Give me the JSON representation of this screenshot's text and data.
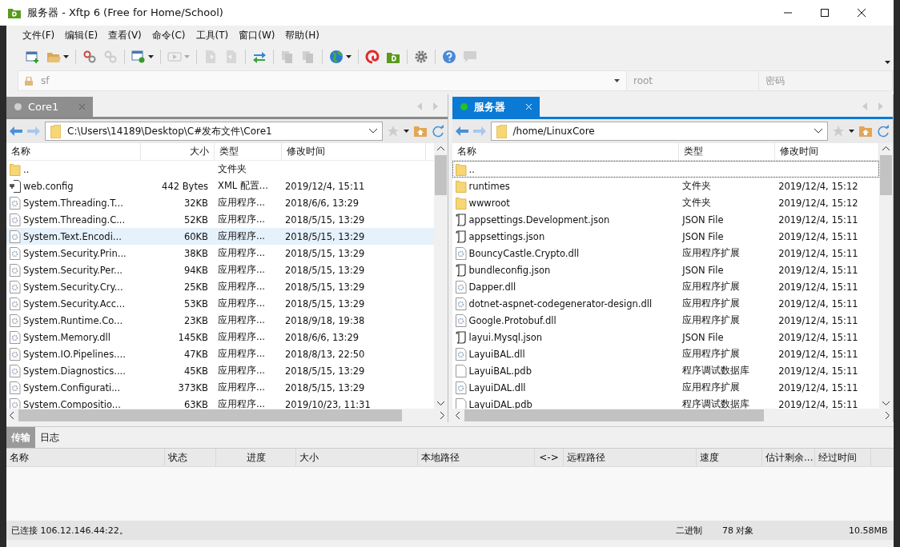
{
  "window": {
    "title": "服务器 - Xftp 6 (Free for Home/School)"
  },
  "menu": [
    "文件(F)",
    "编辑(E)",
    "查看(V)",
    "命令(C)",
    "工具(T)",
    "窗口(W)",
    "帮助(H)"
  ],
  "toolbar": [
    [
      {
        "kind": "new",
        "disabled": false,
        "dropdown": false
      },
      {
        "kind": "open",
        "disabled": false,
        "dropdown": true
      }
    ],
    [
      {
        "kind": "disconnect",
        "disabled": false,
        "dropdown": false
      },
      {
        "kind": "link",
        "disabled": true,
        "dropdown": false
      }
    ],
    [
      {
        "kind": "properties",
        "disabled": false,
        "dropdown": true
      }
    ],
    [
      {
        "kind": "play",
        "disabled": true,
        "dropdown": true
      }
    ],
    [
      {
        "kind": "upload",
        "disabled": true,
        "dropdown": false
      },
      {
        "kind": "download",
        "disabled": true,
        "dropdown": false
      }
    ],
    [
      {
        "kind": "sync",
        "disabled": false,
        "dropdown": false
      }
    ],
    [
      {
        "kind": "copy",
        "disabled": true,
        "dropdown": false
      },
      {
        "kind": "paste",
        "disabled": true,
        "dropdown": false
      }
    ],
    [
      {
        "kind": "globe",
        "disabled": false,
        "dropdown": true
      }
    ],
    [
      {
        "kind": "swirl",
        "disabled": false,
        "dropdown": false
      },
      {
        "kind": "app",
        "disabled": false,
        "dropdown": false
      }
    ],
    [
      {
        "kind": "settings",
        "disabled": false,
        "dropdown": false
      }
    ],
    [
      {
        "kind": "help",
        "disabled": false,
        "dropdown": false
      },
      {
        "kind": "chat",
        "disabled": true,
        "dropdown": false
      }
    ]
  ],
  "address_bar": {
    "host": "sf",
    "user_placeholder": "root",
    "password_placeholder": "密码"
  },
  "panes": [
    {
      "tab": {
        "label": "Core1",
        "selected": false,
        "connected": false
      },
      "path": "C:\\Users\\14189\\Desktop\\C#发布文件\\Core1",
      "columns": [
        {
          "label": "名称",
          "kind": "name"
        },
        {
          "label": "大小",
          "kind": "size"
        },
        {
          "label": "类型",
          "kind": "type"
        },
        {
          "label": "修改时间",
          "kind": "date"
        }
      ],
      "rows": [
        {
          "kind": "folder",
          "name": "..",
          "size": "",
          "type": "文件夹",
          "date": "",
          "selected": false
        },
        {
          "kind": "config",
          "name": "web.config",
          "size": "442 Bytes",
          "type": "XML 配置...",
          "date": "2019/12/4, 15:11",
          "selected": false
        },
        {
          "kind": "dll",
          "name": "System.Threading.T...",
          "size": "32KB",
          "type": "应用程序...",
          "date": "2018/6/6, 13:29",
          "selected": false
        },
        {
          "kind": "dll",
          "name": "System.Threading.C...",
          "size": "52KB",
          "type": "应用程序...",
          "date": "2018/5/15, 13:29",
          "selected": false
        },
        {
          "kind": "dll",
          "name": "System.Text.Encodi...",
          "size": "60KB",
          "type": "应用程序...",
          "date": "2018/5/15, 13:29",
          "selected": true
        },
        {
          "kind": "dll",
          "name": "System.Security.Prin...",
          "size": "38KB",
          "type": "应用程序...",
          "date": "2018/5/15, 13:29",
          "selected": false
        },
        {
          "kind": "dll",
          "name": "System.Security.Per...",
          "size": "94KB",
          "type": "应用程序...",
          "date": "2018/5/15, 13:29",
          "selected": false
        },
        {
          "kind": "dll",
          "name": "System.Security.Cry...",
          "size": "25KB",
          "type": "应用程序...",
          "date": "2018/5/15, 13:29",
          "selected": false
        },
        {
          "kind": "dll",
          "name": "System.Security.Acc...",
          "size": "53KB",
          "type": "应用程序...",
          "date": "2018/5/15, 13:29",
          "selected": false
        },
        {
          "kind": "dll",
          "name": "System.Runtime.Co...",
          "size": "23KB",
          "type": "应用程序...",
          "date": "2018/9/18, 19:38",
          "selected": false
        },
        {
          "kind": "dll",
          "name": "System.Memory.dll",
          "size": "145KB",
          "type": "应用程序...",
          "date": "2018/6/6, 13:29",
          "selected": false
        },
        {
          "kind": "dll",
          "name": "System.IO.Pipelines....",
          "size": "47KB",
          "type": "应用程序...",
          "date": "2018/8/13, 22:50",
          "selected": false
        },
        {
          "kind": "dll",
          "name": "System.Diagnostics....",
          "size": "45KB",
          "type": "应用程序...",
          "date": "2018/5/15, 13:29",
          "selected": false
        },
        {
          "kind": "dll",
          "name": "System.Configurati...",
          "size": "373KB",
          "type": "应用程序...",
          "date": "2018/5/15, 13:29",
          "selected": false
        },
        {
          "kind": "dll",
          "name": "System.Compositio...",
          "size": "63KB",
          "type": "应用程序...",
          "date": "2019/10/23, 11:31",
          "selected": false
        }
      ]
    },
    {
      "tab": {
        "label": "服务器",
        "selected": true,
        "connected": true
      },
      "path": "/home/LinuxCore",
      "columns": [
        {
          "label": "名称",
          "kind": "name"
        },
        {
          "label": "类型",
          "kind": "type"
        },
        {
          "label": "修改时间",
          "kind": "date"
        }
      ],
      "rows": [
        {
          "kind": "folder",
          "name": "..",
          "type": "",
          "date": "",
          "selected": true
        },
        {
          "kind": "folder",
          "name": "runtimes",
          "type": "文件夹",
          "date": "2019/12/4, 15:12",
          "selected": false
        },
        {
          "kind": "folder",
          "name": "wwwroot",
          "type": "文件夹",
          "date": "2019/12/4, 15:12",
          "selected": false
        },
        {
          "kind": "json",
          "name": "appsettings.Development.json",
          "type": "JSON File",
          "date": "2019/12/4, 15:11",
          "selected": false
        },
        {
          "kind": "json",
          "name": "appsettings.json",
          "type": "JSON File",
          "date": "2019/12/4, 15:11",
          "selected": false
        },
        {
          "kind": "dll",
          "name": "BouncyCastle.Crypto.dll",
          "type": "应用程序扩展",
          "date": "2019/12/4, 15:11",
          "selected": false
        },
        {
          "kind": "json",
          "name": "bundleconfig.json",
          "type": "JSON File",
          "date": "2019/12/4, 15:11",
          "selected": false
        },
        {
          "kind": "dll",
          "name": "Dapper.dll",
          "type": "应用程序扩展",
          "date": "2019/12/4, 15:11",
          "selected": false
        },
        {
          "kind": "dll",
          "name": "dotnet-aspnet-codegenerator-design.dll",
          "type": "应用程序扩展",
          "date": "2019/12/4, 15:11",
          "selected": false
        },
        {
          "kind": "dll",
          "name": "Google.Protobuf.dll",
          "type": "应用程序扩展",
          "date": "2019/12/4, 15:11",
          "selected": false
        },
        {
          "kind": "json",
          "name": "layui.Mysql.json",
          "type": "JSON File",
          "date": "2019/12/4, 15:11",
          "selected": false
        },
        {
          "kind": "dll",
          "name": "LayuiBAL.dll",
          "type": "应用程序扩展",
          "date": "2019/12/4, 15:11",
          "selected": false
        },
        {
          "kind": "file",
          "name": "LayuiBAL.pdb",
          "type": "程序调试数据库",
          "date": "2019/12/4, 15:11",
          "selected": false
        },
        {
          "kind": "dll",
          "name": "LayuiDAL.dll",
          "type": "应用程序扩展",
          "date": "2019/12/4, 15:11",
          "selected": false
        },
        {
          "kind": "file",
          "name": "LayuiDAL.pdb",
          "type": "程序调试数据库",
          "date": "2019/12/4, 15:11",
          "selected": false
        }
      ]
    }
  ],
  "bottom_tabs": [
    {
      "label": "传输",
      "selected": true
    },
    {
      "label": "日志",
      "selected": false
    }
  ],
  "transfer_columns": [
    "名称",
    "状态",
    "进度",
    "大小",
    "本地路径",
    "<->",
    "远程路径",
    "速度",
    "估计剩余...",
    "经过时间"
  ],
  "status_bar": {
    "connection": "已连接 106.12.146.44:22。",
    "mode": "二进制",
    "objects": "78 对象",
    "size": "10.58MB"
  }
}
